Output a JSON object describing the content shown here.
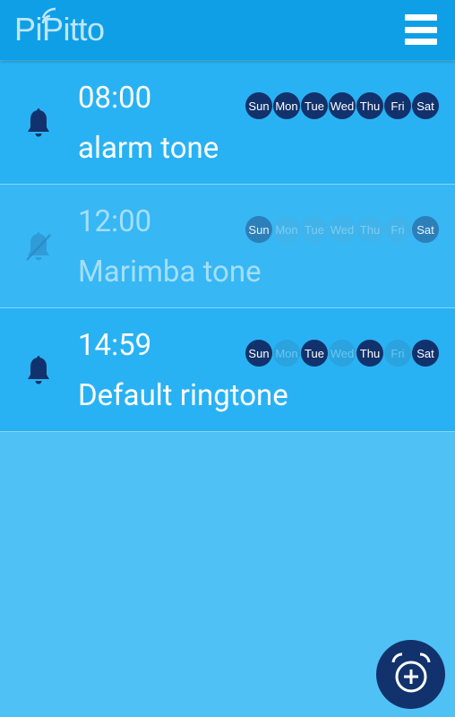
{
  "app": {
    "logo_text": "PiPitto"
  },
  "alarms": [
    {
      "time": "08:00",
      "tone": "alarm tone",
      "enabled": true,
      "days": [
        {
          "label": "Sun",
          "active": true
        },
        {
          "label": "Mon",
          "active": true
        },
        {
          "label": "Tue",
          "active": true
        },
        {
          "label": "Wed",
          "active": true
        },
        {
          "label": "Thu",
          "active": true
        },
        {
          "label": "Fri",
          "active": true
        },
        {
          "label": "Sat",
          "active": true
        }
      ]
    },
    {
      "time": "12:00",
      "tone": "Marimba tone",
      "enabled": false,
      "days": [
        {
          "label": "Sun",
          "active": true
        },
        {
          "label": "Mon",
          "active": false
        },
        {
          "label": "Tue",
          "active": false
        },
        {
          "label": "Wed",
          "active": false
        },
        {
          "label": "Thu",
          "active": false
        },
        {
          "label": "Fri",
          "active": false
        },
        {
          "label": "Sat",
          "active": true
        }
      ]
    },
    {
      "time": "14:59",
      "tone": "Default ringtone",
      "enabled": true,
      "days": [
        {
          "label": "Sun",
          "active": true
        },
        {
          "label": "Mon",
          "active": false
        },
        {
          "label": "Tue",
          "active": true
        },
        {
          "label": "Wed",
          "active": false
        },
        {
          "label": "Thu",
          "active": true
        },
        {
          "label": "Fri",
          "active": false
        },
        {
          "label": "Sat",
          "active": true
        }
      ]
    }
  ],
  "colors": {
    "topbar": "#0e9fe6",
    "background": "#4fc1f5",
    "row": "#29b2f3",
    "active_day": "#12326d",
    "fab": "#12326d"
  },
  "icons": {
    "menu": "hamburger-menu-icon",
    "bell": "bell-icon",
    "bell_off": "bell-off-icon",
    "add_alarm": "add-alarm-icon"
  }
}
